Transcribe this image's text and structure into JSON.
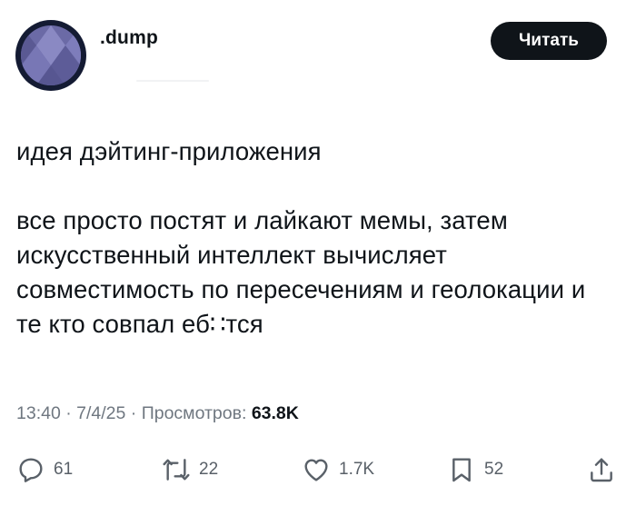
{
  "author": {
    "handle": ".dump",
    "avatar_icon": "diamond-pattern-avatar"
  },
  "read_button_label": "Читать",
  "post": {
    "paragraphs": [
      "идея дэйтинг-приложения",
      "все просто постят и лайкают мемы, затем искусственный интеллект вычисляет совместимость по пересечениям и геолокации и те кто совпал еб∷тся"
    ]
  },
  "meta": {
    "time": "13:40",
    "separator": "·",
    "date": "7/4/25",
    "views_label": "Просмотров:",
    "views_count": "63.8K"
  },
  "actions": {
    "replies": {
      "icon": "reply-icon",
      "count": "61"
    },
    "reposts": {
      "icon": "repost-icon",
      "count": "22"
    },
    "likes": {
      "icon": "heart-icon",
      "count": "1.7K"
    },
    "bookmarks": {
      "icon": "bookmark-icon",
      "count": "52"
    },
    "share": {
      "icon": "share-icon"
    }
  },
  "colors": {
    "text": "#0f1419",
    "muted": "#6f7780",
    "button_bg": "#0f1419",
    "avatar_ring": "#141b33",
    "avatar_fill": "#6b6aa6"
  }
}
